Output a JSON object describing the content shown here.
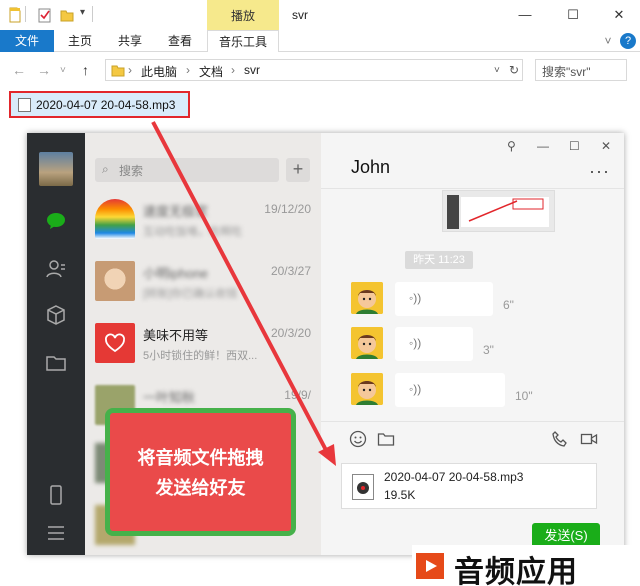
{
  "titlebar": {
    "context_tab": "播放",
    "title": "svr",
    "controls": {
      "minimize": "—",
      "maximize": "☐",
      "close": "✕"
    }
  },
  "ribbon": {
    "tabs": [
      "文件",
      "主页",
      "共享",
      "查看",
      "音乐工具"
    ],
    "collapse": "˅",
    "help": "?"
  },
  "address": {
    "path": [
      "此电脑",
      "文档",
      "svr"
    ],
    "search_placeholder": "搜索\"svr\""
  },
  "file": {
    "name": "2020-04-07 20-04-58.mp3"
  },
  "wechat": {
    "search_placeholder": "搜索",
    "plus": "+",
    "chats": [
      {
        "name": "速度无极家",
        "time": "19/12/20",
        "msg": "互动吃饭咯，吃啊吃",
        "blurred": true,
        "color": "rainbow"
      },
      {
        "name": "小明iphone",
        "time": "20/3/27",
        "msg": "[转账]你已确认收钱",
        "blurred": true,
        "color": "#d8b48a"
      },
      {
        "name": "美味不用等",
        "time": "20/3/20",
        "msg": "5小时锁住的鲜！西双...",
        "blurred": false,
        "color": "#e53935"
      },
      {
        "name": "一叶知秋",
        "time": "19/9/",
        "msg": "",
        "blurred": true,
        "color": "#9aa36a"
      }
    ],
    "contact_name": "John",
    "more": "···",
    "window_controls": {
      "pin": "⚲",
      "minimize": "—",
      "maximize": "☐",
      "close": "✕"
    },
    "timestamp": "昨天 11:23",
    "voices": [
      {
        "duration": "6\""
      },
      {
        "duration": "3\""
      },
      {
        "duration": "10\""
      }
    ],
    "attachment": {
      "name": "2020-04-07 20-04-58.mp3",
      "size": "19.5K"
    },
    "send_label": "发送(S)"
  },
  "overlay": {
    "line1": "将音频文件拖拽",
    "line2": "发送给好友"
  },
  "watermark": {
    "text": "音频应用"
  },
  "colors": {
    "ribbon_file": "#1979ca",
    "context_tab": "#f6e98c",
    "highlight_border": "#e2262b",
    "wechat_green": "#1aad19",
    "hint_fill": "#ea4a4a",
    "hint_border": "#46b14a"
  }
}
